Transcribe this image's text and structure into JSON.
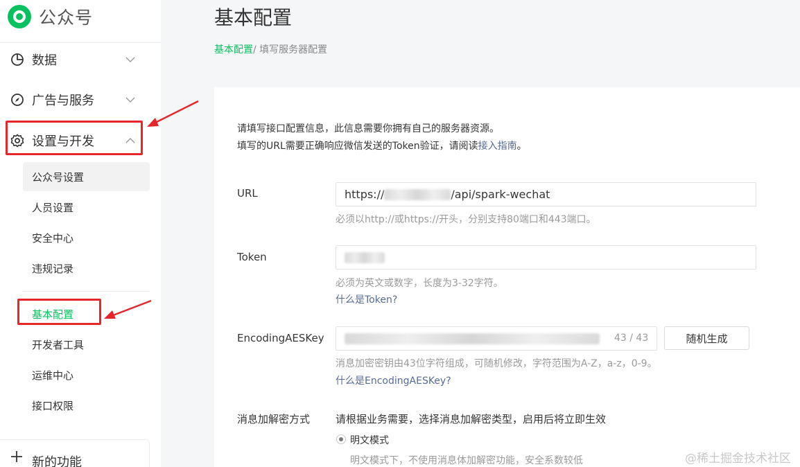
{
  "app": {
    "name": "公众号"
  },
  "sidebar": {
    "groups": [
      {
        "label": "数据",
        "icon": "pie-chart-icon",
        "expanded": false
      },
      {
        "label": "广告与服务",
        "icon": "compass-icon",
        "expanded": false
      },
      {
        "label": "设置与开发",
        "icon": "gear-icon",
        "expanded": true
      }
    ],
    "items": [
      {
        "label": "公众号设置"
      },
      {
        "label": "人员设置"
      },
      {
        "label": "安全中心"
      },
      {
        "label": "违规记录"
      },
      {
        "label": "基本配置",
        "active": true
      },
      {
        "label": "开发者工具"
      },
      {
        "label": "运维中心"
      },
      {
        "label": "接口权限"
      }
    ],
    "new_function": "新的功能"
  },
  "page": {
    "title": "基本配置",
    "breadcrumb": {
      "root": "基本配置",
      "separator": "/ ",
      "current": "填写服务器配置"
    }
  },
  "form": {
    "intro_line1": "请填写接口配置信息，此信息需要你拥有自己的服务器资源。",
    "intro_line2_prefix": "填写的URL需要正确响应微信发送的Token验证，请阅读",
    "intro_line2_link": "接入指南",
    "intro_line2_suffix": "。",
    "url": {
      "label": "URL",
      "value_prefix": "https://",
      "value_suffix": "/api/spark-wechat",
      "hint": "必须以http://或https://开头，分别支持80端口和443端口。"
    },
    "token": {
      "label": "Token",
      "hint": "必须为英文或数字，长度为3-32字符。",
      "help_link": "什么是Token?"
    },
    "aeskey": {
      "label": "EncodingAESKey",
      "counter": "43 / 43",
      "generate_button": "随机生成",
      "hint": "消息加密密钥由43位字符组成，可随机修改，字符范围为A-Z，a-z，0-9。",
      "help_link": "什么是EncodingAESKey?"
    },
    "encryption": {
      "label": "消息加解密方式",
      "description": "请根据业务需要，选择消息加解密类型，启用后将立即生效",
      "option_plain": "明文模式",
      "option_plain_desc": "明文模式下，不使用消息体加解密功能，安全系数较低"
    }
  },
  "watermark": "@稀土掘金技术社区",
  "colors": {
    "accent": "#07c160",
    "link": "#576b95",
    "annotation": "#e5262b"
  }
}
